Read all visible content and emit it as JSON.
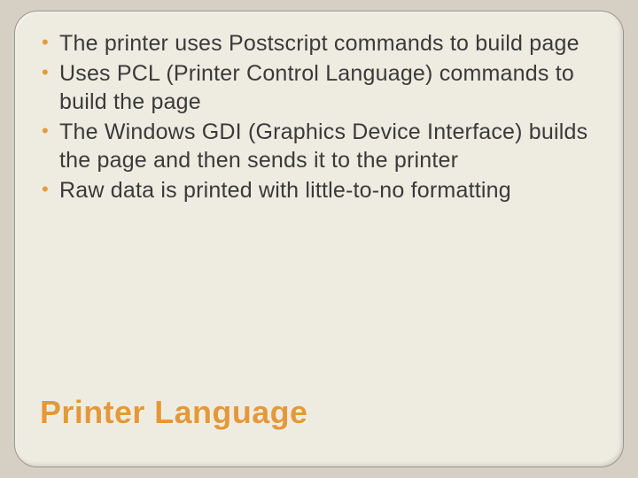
{
  "slide": {
    "title": "Printer Language",
    "bullets": [
      "The printer uses Postscript commands to build page",
      "Uses PCL (Printer Control Language) commands to build the page",
      "The Windows GDI (Graphics Device Interface) builds the page and then sends it to the printer",
      "Raw data is printed with little-to-no formatting"
    ]
  },
  "colors": {
    "accent": "#e5983a",
    "card_bg": "#eeece1",
    "page_bg": "#d6d0c4",
    "text": "#3a3a3a"
  }
}
